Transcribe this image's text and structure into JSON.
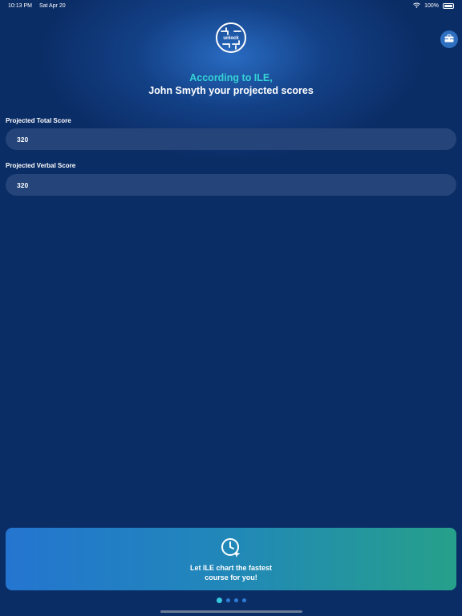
{
  "status_bar": {
    "time": "10:13 PM",
    "date": "Sat Apr 20",
    "battery": "100%",
    "icons": [
      "wifi-icon",
      "battery-icon"
    ]
  },
  "logo": {
    "text": "unlock"
  },
  "header": {
    "line1": "According to ILE,",
    "line2": "John Smyth your projected scores",
    "toolbox_icon": "toolbox-icon"
  },
  "fields": [
    {
      "label": "Projected Total Score",
      "value": "320"
    },
    {
      "label": "Projected Verbal Score",
      "value": "320"
    }
  ],
  "cta": {
    "icon": "clock-sparkle-icon",
    "text": "Let ILE chart the fastest course for you!"
  },
  "pagination": {
    "total": 4,
    "active": 1
  },
  "colors": {
    "background": "#0b2d66",
    "accent_teal": "#36d3d6",
    "field_bg": "#24447a",
    "cta_gradient_start": "#2475d0",
    "cta_gradient_end": "#26a08a"
  }
}
